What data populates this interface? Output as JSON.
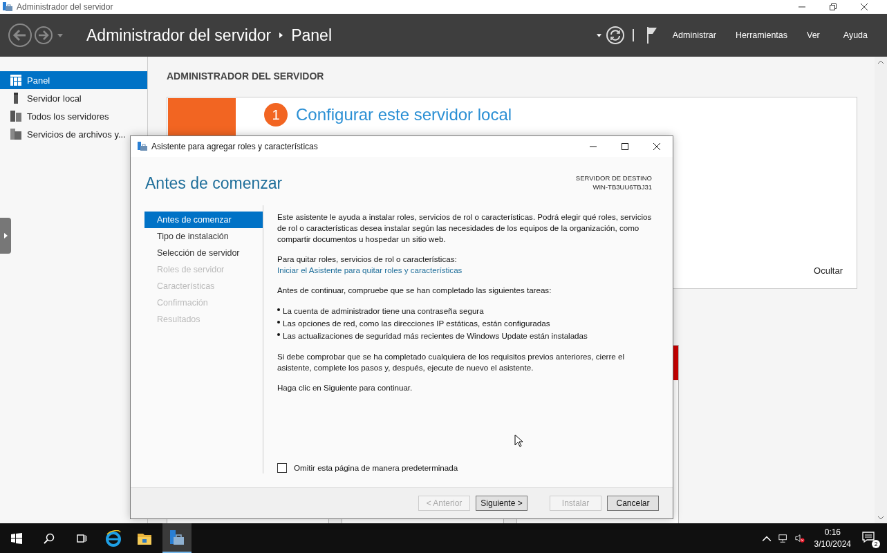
{
  "window": {
    "title": "Administrador del servidor"
  },
  "header": {
    "breadcrumb": [
      "Administrador del servidor",
      "Panel"
    ],
    "menu": [
      "Administrar",
      "Herramientas",
      "Ver",
      "Ayuda"
    ]
  },
  "sidebar": {
    "items": [
      {
        "label": "Panel",
        "selected": true
      },
      {
        "label": "Servidor local",
        "selected": false
      },
      {
        "label": "Todos los servidores",
        "selected": false
      },
      {
        "label": "Servicios de archivos y...",
        "selected": false
      }
    ]
  },
  "content": {
    "heading": "ADMINISTRADOR DEL SERVIDOR",
    "card": {
      "step": "1",
      "title": "Configurar este servidor local",
      "hide": "Ocultar"
    }
  },
  "dialog": {
    "title": "Asistente para agregar roles y características",
    "page_title": "Antes de comenzar",
    "destination_label": "SERVIDOR DE DESTINO",
    "destination_server": "WIN-TB3UU6TBJ31",
    "steps": [
      {
        "label": "Antes de comenzar",
        "selected": true,
        "disabled": false
      },
      {
        "label": "Tipo de instalación",
        "selected": false,
        "disabled": false
      },
      {
        "label": "Selección de servidor",
        "selected": false,
        "disabled": false
      },
      {
        "label": "Roles de servidor",
        "selected": false,
        "disabled": true
      },
      {
        "label": "Características",
        "selected": false,
        "disabled": true
      },
      {
        "label": "Confirmación",
        "selected": false,
        "disabled": true
      },
      {
        "label": "Resultados",
        "selected": false,
        "disabled": true
      }
    ],
    "intro": "Este asistente le ayuda a instalar roles, servicios de rol o características. Podrá elegir qué roles, servicios de rol o características desea instalar según las necesidades de los equipos de la organización, como compartir documentos u hospedar un sitio web.",
    "remove_label": "Para quitar roles, servicios de rol o características:",
    "remove_link": "Iniciar el Asistente para quitar roles y características",
    "prereq_intro": "Antes de continuar, compruebe que se han completado las siguientes tareas:",
    "prereqs": [
      "La cuenta de administrador tiene una contraseña segura",
      "Las opciones de red, como las direcciones IP estáticas, están configuradas",
      "Las actualizaciones de seguridad más recientes de Windows Update están instaladas"
    ],
    "closing": "Si debe comprobar que se ha completado cualquiera de los requisitos previos anteriores, cierre el asistente, complete los pasos y, después, ejecute de nuevo el asistente.",
    "next_hint": "Haga clic en Siguiente para continuar.",
    "skip_checkbox": {
      "label": "Omitir esta página de manera predeterminada",
      "checked": false
    },
    "buttons": [
      {
        "label": "< Anterior",
        "disabled": true
      },
      {
        "label": "Siguiente >",
        "disabled": false
      },
      {
        "label": "Instalar",
        "disabled": true
      },
      {
        "label": "Cancelar",
        "disabled": false
      }
    ]
  },
  "taskbar": {
    "time": "0:16",
    "date": "3/10/2024",
    "notifications": "2"
  }
}
